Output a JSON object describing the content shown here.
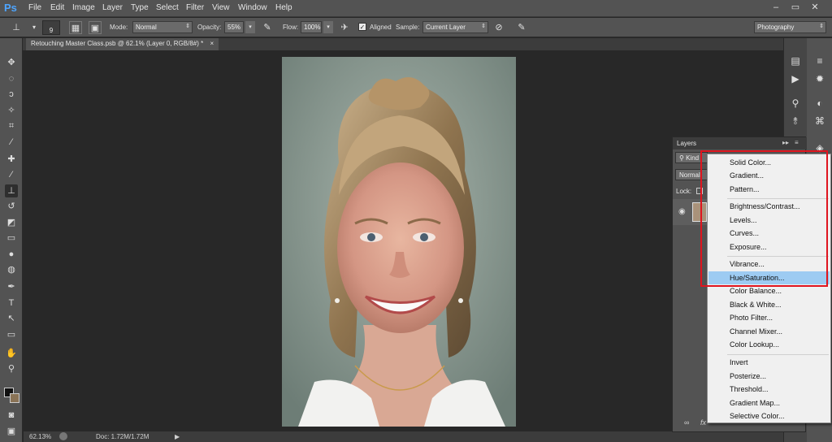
{
  "app": {
    "logo": "Ps",
    "workspace": "Photography"
  },
  "menubar": [
    "File",
    "Edit",
    "Image",
    "Layer",
    "Type",
    "Select",
    "Filter",
    "View",
    "Window",
    "Help"
  ],
  "window_controls": {
    "minimize": "–",
    "restore": "▭",
    "close": "✕"
  },
  "options": {
    "brush_size": "9",
    "mode_label": "Mode:",
    "mode_value": "Normal",
    "opacity_label": "Opacity:",
    "opacity_value": "55%",
    "flow_label": "Flow:",
    "flow_value": "100%",
    "aligned_label": "Aligned",
    "sample_label": "Sample:",
    "sample_value": "Current Layer"
  },
  "document": {
    "tab_title": "Retouching Master Class.psb @ 62.1% (Layer 0, RGB/8#) *",
    "close": "×"
  },
  "status": {
    "zoom": "62.13%",
    "doc": "Doc: 1.72M/1.72M",
    "arrow": "▶"
  },
  "layers_panel": {
    "title": "Layers",
    "kind_label": "Kind",
    "blend_value": "Normal",
    "lock_label": "Lock:",
    "bottom_icons": "fx"
  },
  "context_menu": {
    "items": [
      "Solid Color...",
      "Gradient...",
      "Pattern...",
      "Brightness/Contrast...",
      "Levels...",
      "Curves...",
      "Exposure...",
      "Vibrance...",
      "Hue/Saturation...",
      "Color Balance...",
      "Black & White...",
      "Photo Filter...",
      "Channel Mixer...",
      "Color Lookup...",
      "Invert",
      "Posterize...",
      "Threshold...",
      "Gradient Map...",
      "Selective Color..."
    ],
    "highlighted": "Hue/Saturation..."
  },
  "colors": {
    "highlight": "#9dcbf2",
    "annotation_box": "#e0141e",
    "logo": "#4ea5ff"
  }
}
